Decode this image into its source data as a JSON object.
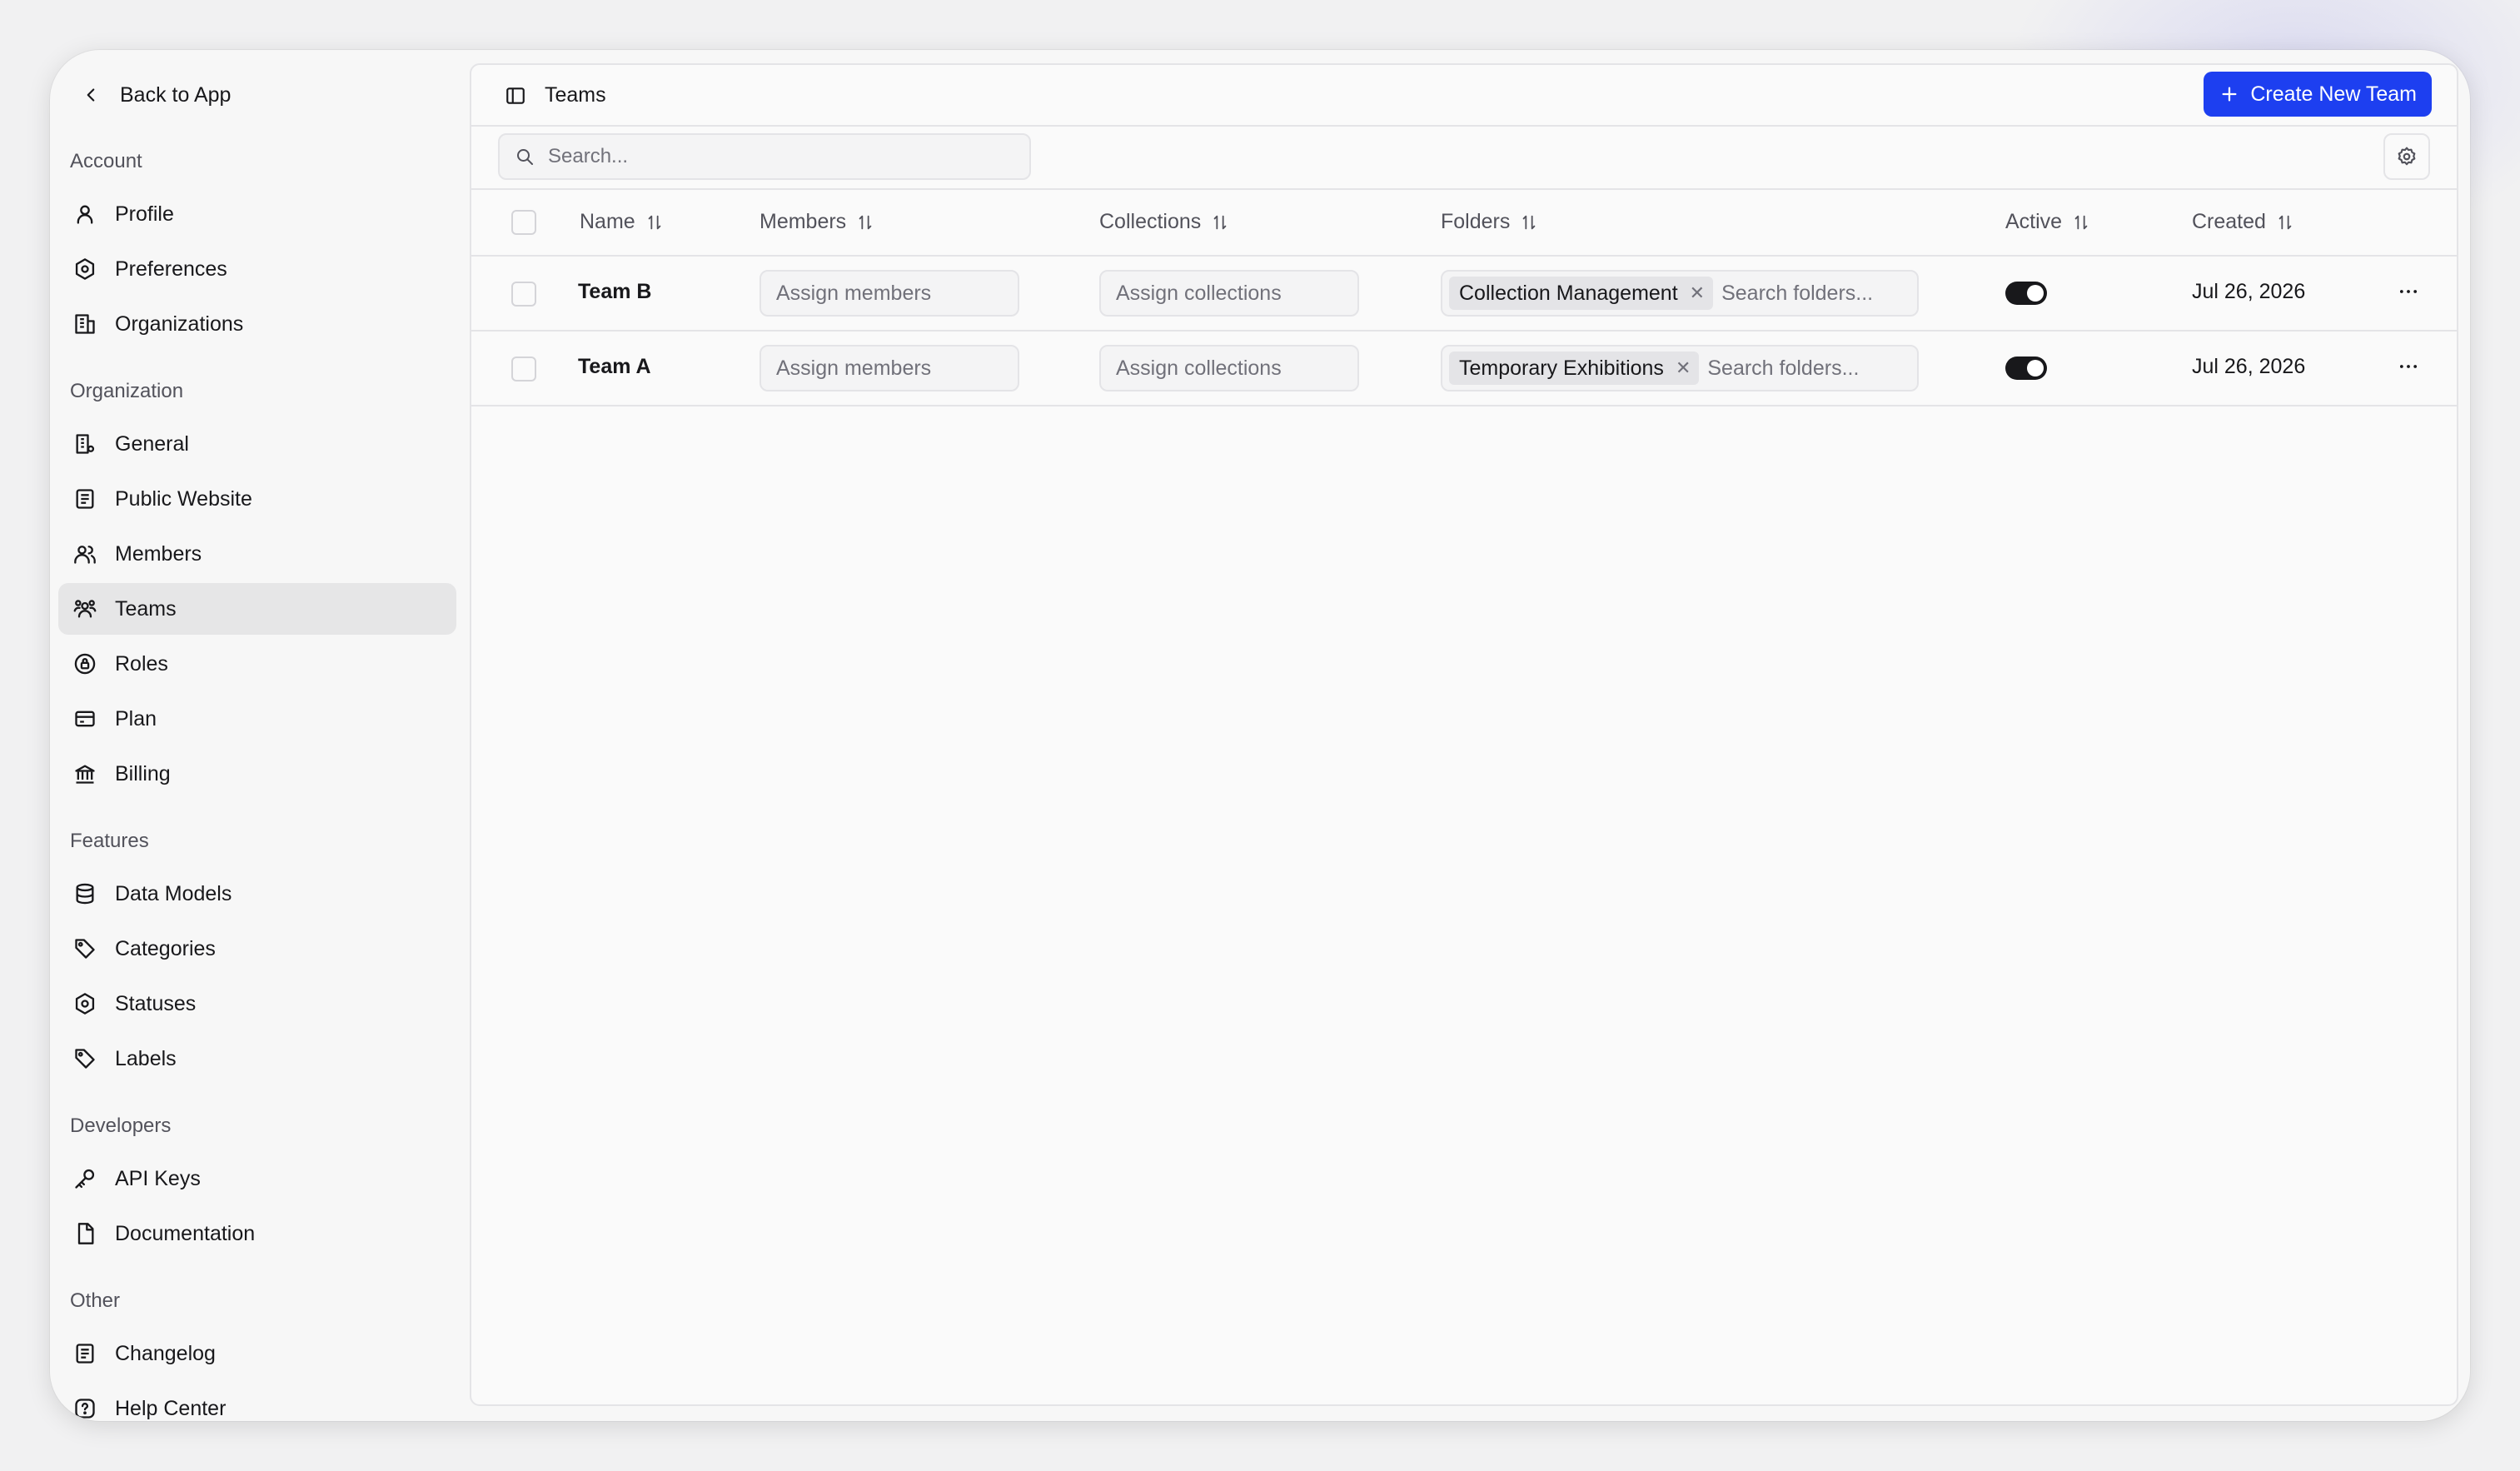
{
  "sidebar": {
    "back_label": "Back to App",
    "sections": {
      "account": "Account",
      "organization": "Organization",
      "features": "Features",
      "developers": "Developers",
      "other": "Other"
    },
    "items": {
      "profile": "Profile",
      "preferences": "Preferences",
      "organizations": "Organizations",
      "general": "General",
      "public_website": "Public Website",
      "members": "Members",
      "teams": "Teams",
      "roles": "Roles",
      "plan": "Plan",
      "billing": "Billing",
      "data_models": "Data Models",
      "categories": "Categories",
      "statuses": "Statuses",
      "labels": "Labels",
      "api_keys": "API Keys",
      "documentation": "Documentation",
      "changelog": "Changelog",
      "help_center": "Help Center"
    },
    "active_item": "teams"
  },
  "header": {
    "title": "Teams",
    "create_button": "Create New Team"
  },
  "search": {
    "placeholder": "Search..."
  },
  "table": {
    "columns": {
      "name": "Name",
      "members": "Members",
      "collections": "Collections",
      "folders": "Folders",
      "active": "Active",
      "created": "Created"
    },
    "rows": [
      {
        "name": "Team B",
        "members_placeholder": "Assign members",
        "collections_placeholder": "Assign collections",
        "folder_tag": "Collection Management",
        "folder_search_placeholder": "Search folders...",
        "active": true,
        "created": "Jul 26, 2026"
      },
      {
        "name": "Team A",
        "members_placeholder": "Assign members",
        "collections_placeholder": "Assign collections",
        "folder_tag": "Temporary Exhibitions",
        "folder_search_placeholder": "Search folders...",
        "active": true,
        "created": "Jul 26, 2026"
      }
    ]
  },
  "colors": {
    "accent": "#1d3ff0",
    "active_nav_bg": "#e6e6e7",
    "toggle_on": "#18181b"
  }
}
